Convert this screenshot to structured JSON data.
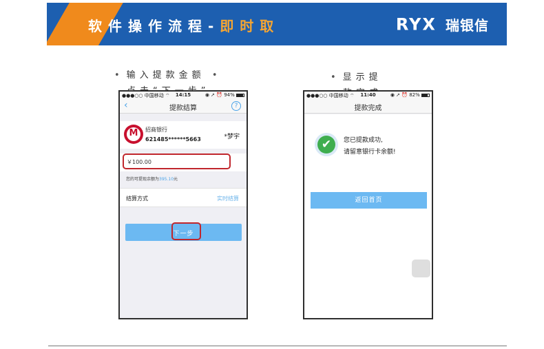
{
  "header": {
    "title_main": "软件操作流程",
    "title_sep": "-",
    "title_accent": "即时取",
    "brand_logo_a": "RY",
    "brand_logo_b": "X",
    "brand_cn": "瑞银信"
  },
  "captions": {
    "step1_line1": "输入提款金额",
    "step1_dot": "•",
    "step1_line2": "点击“下一步”",
    "step2_line1": "显示提",
    "step2_line2": "款完成"
  },
  "phone1": {
    "carrier": "●●●○○ 中国移动 ⌔",
    "time": "14:15",
    "status_right": "◉ ➚ ⏰ 94%",
    "battery_fraction": 0.94,
    "nav_title": "提款结算",
    "back_glyph": "‹",
    "help_glyph": "?",
    "bank_logo_glyph": "M",
    "bank_name": "招商银行",
    "card_number": "621485******5663",
    "holder": "*梦宇",
    "amount": "￥100.00",
    "avail_prefix": "您的可提现余额为",
    "avail_amount": "395.10",
    "avail_unit": "元",
    "settle_label": "结算方式",
    "settle_value": "实时结算",
    "next_button": "下一步"
  },
  "phone2": {
    "carrier": "●●●○○ 中国移动 ⌔",
    "time": "11:40",
    "status_right": "◉ ➚ ⏰ 82%",
    "battery_fraction": 0.82,
    "nav_title": "提款完成",
    "check_glyph": "✔",
    "success_line1": "您已提款成功,",
    "success_line2": "请留意银行卡余额!",
    "home_button": "返回首页"
  },
  "colors": {
    "banner_blue": "#1d5fb0",
    "banner_orange": "#f08a1c",
    "accent_text": "#f6a531",
    "button_blue": "#6cb9f2",
    "highlight_red": "#c0262c",
    "success_green": "#3fae4f"
  }
}
